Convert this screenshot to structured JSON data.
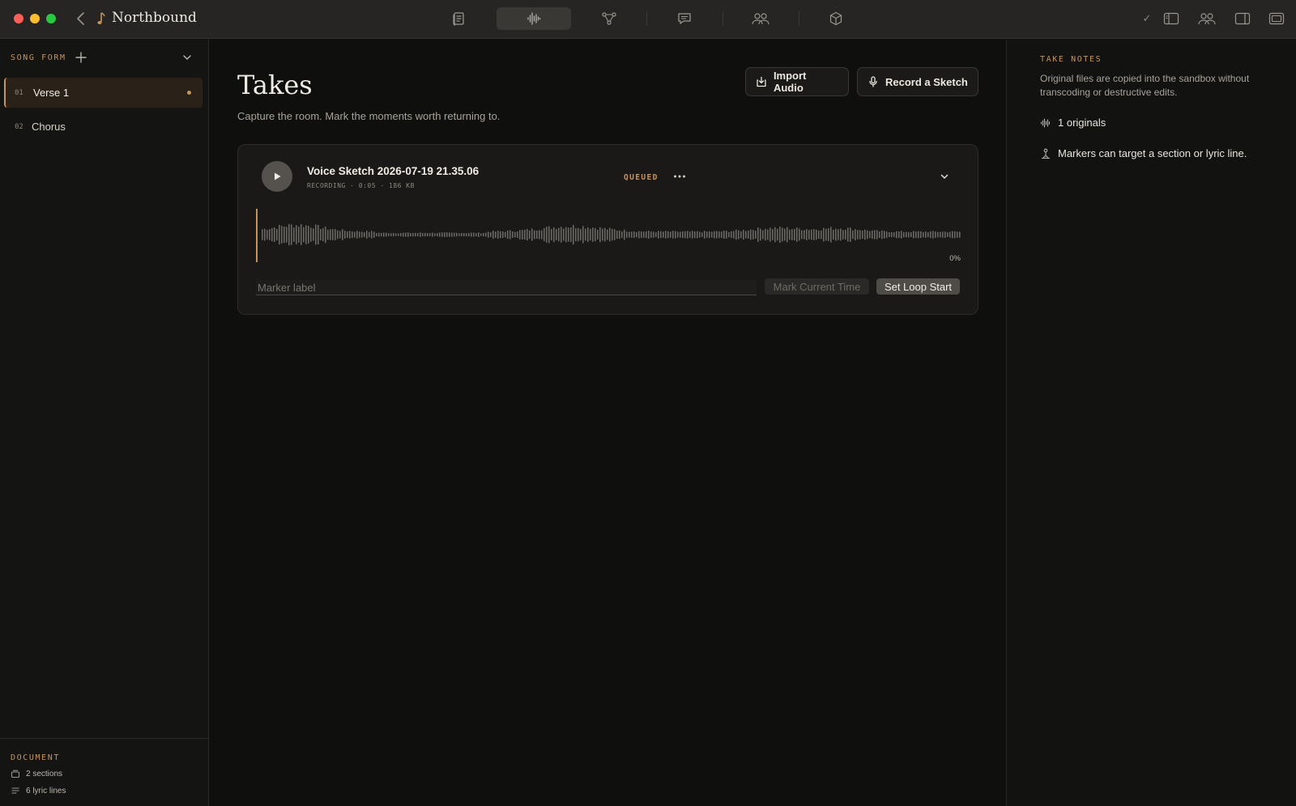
{
  "window": {
    "title": "Northbound",
    "toolbar": [
      {
        "name": "lyrics-tool",
        "icon": "document-icon",
        "active": false
      },
      {
        "name": "takes-tool",
        "icon": "waveform-icon",
        "active": true
      },
      {
        "name": "graph-tool",
        "icon": "nodes-icon",
        "active": false
      },
      {
        "name": "comments-tool",
        "icon": "chat-icon",
        "active": false
      },
      {
        "name": "collaborators-tool",
        "icon": "people-icon",
        "active": false
      },
      {
        "name": "package-tool",
        "icon": "box-icon",
        "active": false
      }
    ],
    "right_icons": [
      "check-icon",
      "left-sidebar-icon",
      "people-icon",
      "right-sidebar-icon",
      "fullscreen-icon"
    ],
    "check": "✓"
  },
  "sidebar": {
    "header": "SONG FORM",
    "items": [
      {
        "num": "01",
        "label": "Verse 1",
        "active": true
      },
      {
        "num": "02",
        "label": "Chorus",
        "active": false
      }
    ],
    "footer": {
      "header": "DOCUMENT",
      "sections": "2 sections",
      "lyric_lines": "6 lyric lines"
    }
  },
  "main": {
    "title": "Takes",
    "subtitle": "Capture the room. Mark the moments worth returning to.",
    "import_label": "Import Audio",
    "record_label": "Record a Sketch",
    "take": {
      "title": "Voice Sketch 2026-07-19 21.35.06",
      "meta": "RECORDING · 0:05 · 186 KB",
      "status": "QUEUED",
      "progress_label": "0%",
      "progress": 0,
      "marker_placeholder": "Marker label",
      "mark_label": "Mark Current Time",
      "loop_label": "Set Loop Start"
    }
  },
  "notes": {
    "header": "TAKE NOTES",
    "description": "Original files are copied into the sandbox without transcoding or destructive edits.",
    "originals": "1 originals",
    "markers": "Markers can target a section or lyric line."
  },
  "colors": {
    "accent": "#c8935a",
    "background": "#0f0f0e",
    "wave": "#6b6863"
  }
}
